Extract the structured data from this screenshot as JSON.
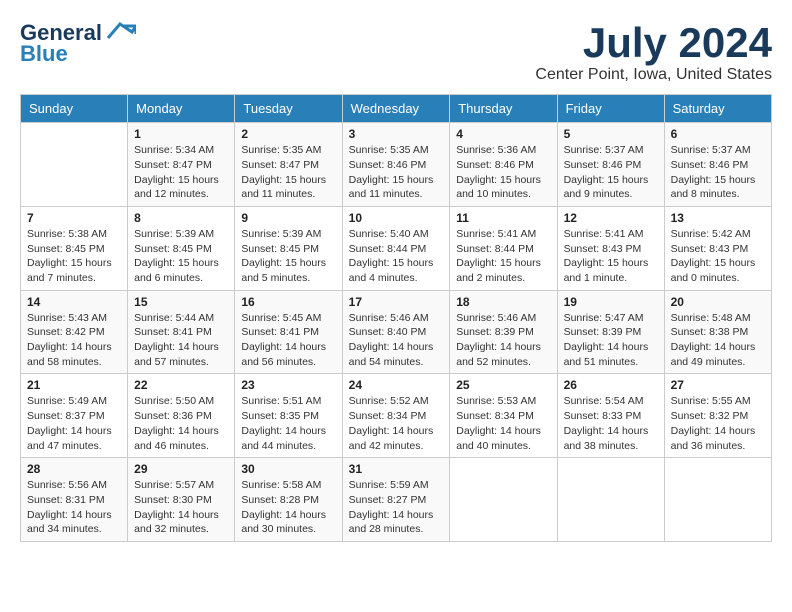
{
  "header": {
    "logo_general": "General",
    "logo_blue": "Blue",
    "title": "July 2024",
    "subtitle": "Center Point, Iowa, United States"
  },
  "calendar": {
    "days_of_week": [
      "Sunday",
      "Monday",
      "Tuesday",
      "Wednesday",
      "Thursday",
      "Friday",
      "Saturday"
    ],
    "weeks": [
      [
        {
          "day": "",
          "info": ""
        },
        {
          "day": "1",
          "info": "Sunrise: 5:34 AM\nSunset: 8:47 PM\nDaylight: 15 hours\nand 12 minutes."
        },
        {
          "day": "2",
          "info": "Sunrise: 5:35 AM\nSunset: 8:47 PM\nDaylight: 15 hours\nand 11 minutes."
        },
        {
          "day": "3",
          "info": "Sunrise: 5:35 AM\nSunset: 8:46 PM\nDaylight: 15 hours\nand 11 minutes."
        },
        {
          "day": "4",
          "info": "Sunrise: 5:36 AM\nSunset: 8:46 PM\nDaylight: 15 hours\nand 10 minutes."
        },
        {
          "day": "5",
          "info": "Sunrise: 5:37 AM\nSunset: 8:46 PM\nDaylight: 15 hours\nand 9 minutes."
        },
        {
          "day": "6",
          "info": "Sunrise: 5:37 AM\nSunset: 8:46 PM\nDaylight: 15 hours\nand 8 minutes."
        }
      ],
      [
        {
          "day": "7",
          "info": "Sunrise: 5:38 AM\nSunset: 8:45 PM\nDaylight: 15 hours\nand 7 minutes."
        },
        {
          "day": "8",
          "info": "Sunrise: 5:39 AM\nSunset: 8:45 PM\nDaylight: 15 hours\nand 6 minutes."
        },
        {
          "day": "9",
          "info": "Sunrise: 5:39 AM\nSunset: 8:45 PM\nDaylight: 15 hours\nand 5 minutes."
        },
        {
          "day": "10",
          "info": "Sunrise: 5:40 AM\nSunset: 8:44 PM\nDaylight: 15 hours\nand 4 minutes."
        },
        {
          "day": "11",
          "info": "Sunrise: 5:41 AM\nSunset: 8:44 PM\nDaylight: 15 hours\nand 2 minutes."
        },
        {
          "day": "12",
          "info": "Sunrise: 5:41 AM\nSunset: 8:43 PM\nDaylight: 15 hours\nand 1 minute."
        },
        {
          "day": "13",
          "info": "Sunrise: 5:42 AM\nSunset: 8:43 PM\nDaylight: 15 hours\nand 0 minutes."
        }
      ],
      [
        {
          "day": "14",
          "info": "Sunrise: 5:43 AM\nSunset: 8:42 PM\nDaylight: 14 hours\nand 58 minutes."
        },
        {
          "day": "15",
          "info": "Sunrise: 5:44 AM\nSunset: 8:41 PM\nDaylight: 14 hours\nand 57 minutes."
        },
        {
          "day": "16",
          "info": "Sunrise: 5:45 AM\nSunset: 8:41 PM\nDaylight: 14 hours\nand 56 minutes."
        },
        {
          "day": "17",
          "info": "Sunrise: 5:46 AM\nSunset: 8:40 PM\nDaylight: 14 hours\nand 54 minutes."
        },
        {
          "day": "18",
          "info": "Sunrise: 5:46 AM\nSunset: 8:39 PM\nDaylight: 14 hours\nand 52 minutes."
        },
        {
          "day": "19",
          "info": "Sunrise: 5:47 AM\nSunset: 8:39 PM\nDaylight: 14 hours\nand 51 minutes."
        },
        {
          "day": "20",
          "info": "Sunrise: 5:48 AM\nSunset: 8:38 PM\nDaylight: 14 hours\nand 49 minutes."
        }
      ],
      [
        {
          "day": "21",
          "info": "Sunrise: 5:49 AM\nSunset: 8:37 PM\nDaylight: 14 hours\nand 47 minutes."
        },
        {
          "day": "22",
          "info": "Sunrise: 5:50 AM\nSunset: 8:36 PM\nDaylight: 14 hours\nand 46 minutes."
        },
        {
          "day": "23",
          "info": "Sunrise: 5:51 AM\nSunset: 8:35 PM\nDaylight: 14 hours\nand 44 minutes."
        },
        {
          "day": "24",
          "info": "Sunrise: 5:52 AM\nSunset: 8:34 PM\nDaylight: 14 hours\nand 42 minutes."
        },
        {
          "day": "25",
          "info": "Sunrise: 5:53 AM\nSunset: 8:34 PM\nDaylight: 14 hours\nand 40 minutes."
        },
        {
          "day": "26",
          "info": "Sunrise: 5:54 AM\nSunset: 8:33 PM\nDaylight: 14 hours\nand 38 minutes."
        },
        {
          "day": "27",
          "info": "Sunrise: 5:55 AM\nSunset: 8:32 PM\nDaylight: 14 hours\nand 36 minutes."
        }
      ],
      [
        {
          "day": "28",
          "info": "Sunrise: 5:56 AM\nSunset: 8:31 PM\nDaylight: 14 hours\nand 34 minutes."
        },
        {
          "day": "29",
          "info": "Sunrise: 5:57 AM\nSunset: 8:30 PM\nDaylight: 14 hours\nand 32 minutes."
        },
        {
          "day": "30",
          "info": "Sunrise: 5:58 AM\nSunset: 8:28 PM\nDaylight: 14 hours\nand 30 minutes."
        },
        {
          "day": "31",
          "info": "Sunrise: 5:59 AM\nSunset: 8:27 PM\nDaylight: 14 hours\nand 28 minutes."
        },
        {
          "day": "",
          "info": ""
        },
        {
          "day": "",
          "info": ""
        },
        {
          "day": "",
          "info": ""
        }
      ]
    ]
  }
}
